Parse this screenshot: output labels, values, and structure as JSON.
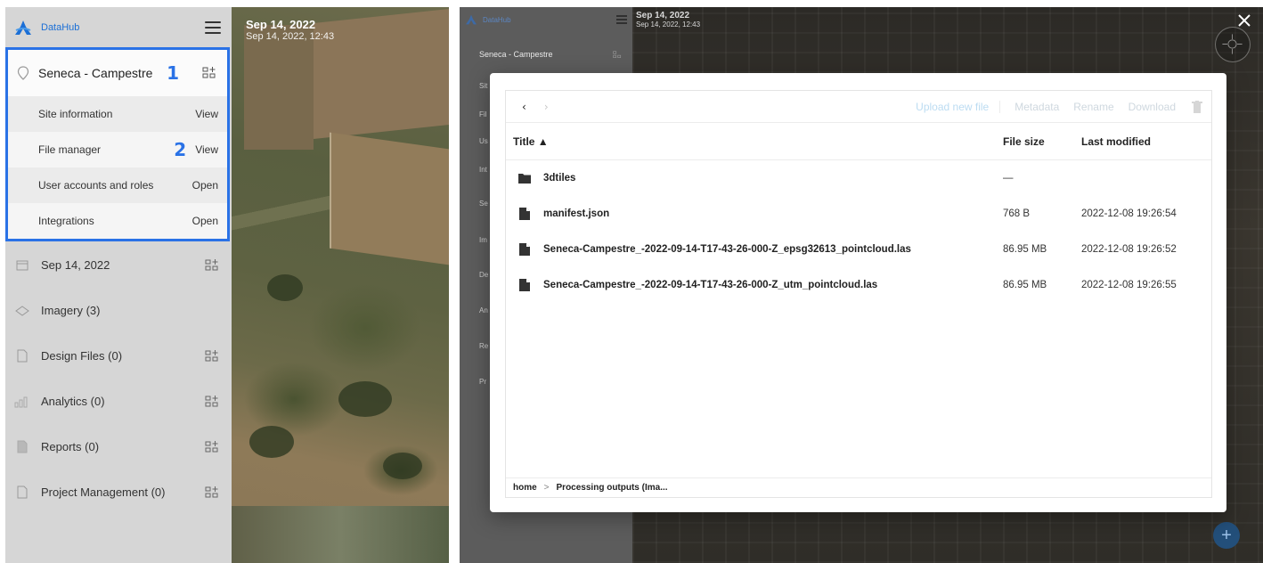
{
  "left": {
    "brand": "DataHub",
    "site": {
      "title": "Seneca - Campestre",
      "step_badge": "1",
      "items": [
        {
          "label": "Site information",
          "action": "View"
        },
        {
          "label": "File manager",
          "action": "View",
          "badge": "2"
        },
        {
          "label": "User accounts and roles",
          "action": "Open"
        },
        {
          "label": "Integrations",
          "action": "Open"
        }
      ]
    },
    "nav": [
      {
        "label": "Sep 14, 2022",
        "icon": "calendar-icon",
        "has_add": true
      },
      {
        "label": "Imagery (3)",
        "icon": "layers-icon",
        "has_add": false
      },
      {
        "label": "Design Files (0)",
        "icon": "file-icon",
        "has_add": true
      },
      {
        "label": "Analytics (0)",
        "icon": "bar-chart-icon",
        "has_add": true
      },
      {
        "label": "Reports (0)",
        "icon": "report-icon",
        "has_add": true
      },
      {
        "label": "Project Management (0)",
        "icon": "file-icon",
        "has_add": true
      }
    ],
    "map_date": {
      "date": "Sep 14, 2022",
      "datetime": "Sep 14, 2022, 12:43"
    }
  },
  "right": {
    "brand": "DataHub",
    "map_date": {
      "date": "Sep 14, 2022",
      "datetime": "Sep 14, 2022, 12:43"
    },
    "site_title": "Seneca - Campestre",
    "fragments": [
      "Sit",
      "Fil",
      "Us",
      "Int",
      "Se",
      "Im",
      "De",
      "An",
      "Re",
      "Pr"
    ],
    "file_manager": {
      "toolbar": {
        "back": "‹",
        "forward": "›",
        "upload": "Upload new file",
        "metadata": "Metadata",
        "rename": "Rename",
        "download": "Download"
      },
      "columns": {
        "title": "Title ▲",
        "size": "File size",
        "modified": "Last modified"
      },
      "rows": [
        {
          "type": "folder",
          "name": "3dtiles",
          "size": "—",
          "modified": ""
        },
        {
          "type": "file",
          "name": "manifest.json",
          "size": "768 B",
          "modified": "2022-12-08 19:26:54"
        },
        {
          "type": "file",
          "name": "Seneca-Campestre_-2022-09-14-T17-43-26-000-Z_epsg32613_pointcloud.las",
          "size": "86.95 MB",
          "modified": "2022-12-08 19:26:52"
        },
        {
          "type": "file",
          "name": "Seneca-Campestre_-2022-09-14-T17-43-26-000-Z_utm_pointcloud.las",
          "size": "86.95 MB",
          "modified": "2022-12-08 19:26:55"
        }
      ],
      "breadcrumb": {
        "home": "home",
        "separator": ">",
        "current": "Processing outputs (Ima..."
      }
    },
    "fab": "+"
  },
  "colors": {
    "accent": "#2a72e6",
    "brand": "#1b6fd6"
  }
}
